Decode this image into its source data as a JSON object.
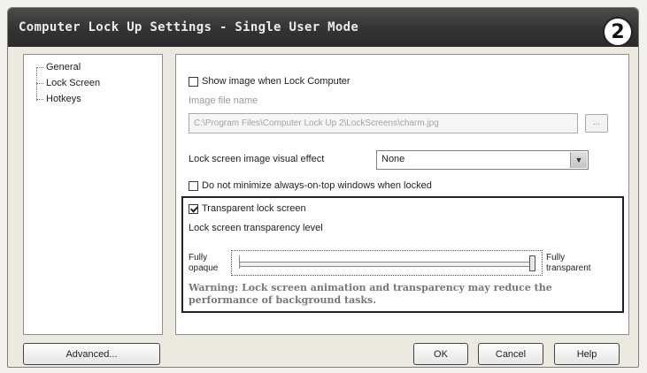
{
  "window": {
    "title": "Computer Lock Up Settings - Single User Mode",
    "step_badge": "2"
  },
  "tree": {
    "items": [
      {
        "label": "General"
      },
      {
        "label": "Lock Screen"
      },
      {
        "label": "Hotkeys"
      }
    ]
  },
  "panel": {
    "show_image": {
      "label": "Show image when Lock Computer",
      "checked": false
    },
    "image_file": {
      "label": "Image file name",
      "value": "C:\\Program Files\\Computer Lock Up 2\\LockScreens\\charm.jpg",
      "browse_label": "..."
    },
    "visual_effect": {
      "label": "Lock screen image visual effect",
      "value": "None"
    },
    "no_minimize": {
      "label": "Do not minimize always-on-top windows when locked",
      "checked": false
    },
    "transparent": {
      "label": "Transparent lock screen",
      "checked": true
    },
    "transparency_level_label": "Lock screen transparency level",
    "slider": {
      "min_label": "Fully opaque",
      "max_label": "Fully transparent",
      "value": 1.0
    },
    "warning": "Warning: Lock screen animation and transparency may reduce the performance of background tasks."
  },
  "buttons": {
    "advanced": "Advanced...",
    "ok": "OK",
    "cancel": "Cancel",
    "help": "Help"
  }
}
